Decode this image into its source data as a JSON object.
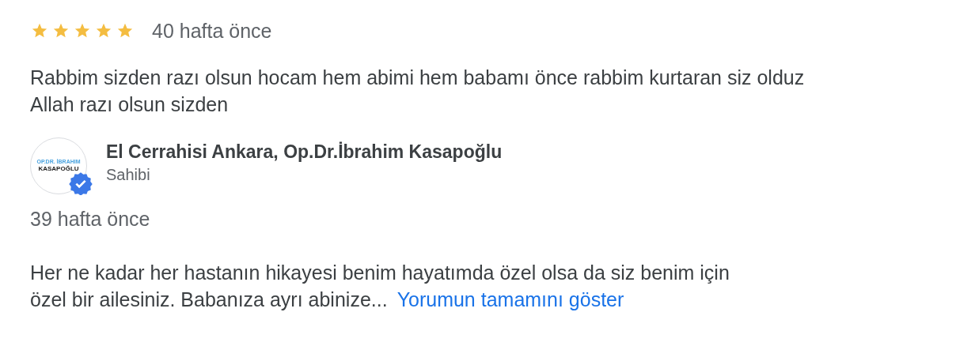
{
  "review": {
    "stars": 5,
    "time": "40 hafta önce",
    "text": "Rabbim sizden razı olsun hocam hem abimi hem babamı önce rabbim kurtaran siz olduz Allah razı olsun sizden"
  },
  "owner_reply": {
    "logo_line_1": "OP.DR. İBRAHIM",
    "logo_line_2": "KASAPOĞLU",
    "verified": true,
    "name": "El Cerrahisi Ankara, Op.Dr.İbrahim Kasapoğlu",
    "role": "Sahibi",
    "time": "39 hafta önce",
    "text": "Her ne kadar her hastanın hikayesi benim hayatımda özel olsa da siz benim için özel bir ailesiniz. Babanıza ayrı abinize...",
    "more_link": "Yorumun tamamını göster"
  }
}
